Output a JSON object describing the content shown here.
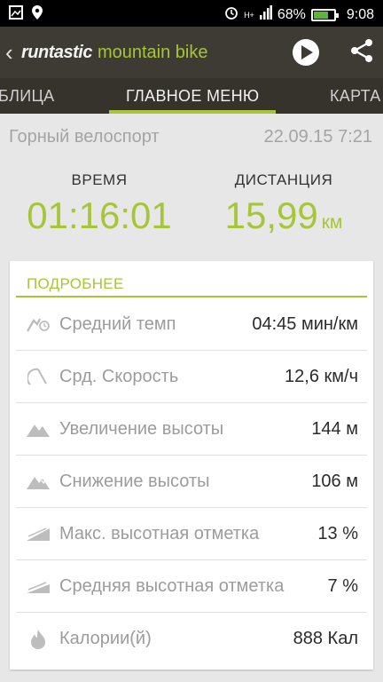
{
  "statusbar": {
    "battery_percent": "68%",
    "time": "9:08",
    "network": "H+"
  },
  "appbar": {
    "brand_name": "runtastic",
    "brand_product": "mountain bike"
  },
  "tabs": {
    "left": "БЛИЦА",
    "main": "ГЛАВНОЕ МЕНЮ",
    "right": "КАРТА"
  },
  "activity": {
    "sport": "Горный велоспорт",
    "datetime": "22.09.15 7:21"
  },
  "metrics": {
    "time_label": "ВРЕМЯ",
    "time_value": "01:16:01",
    "distance_label": "ДИСТАНЦИЯ",
    "distance_value": "15,99",
    "distance_unit": "км"
  },
  "details": {
    "header": "ПОДРОБНЕЕ",
    "rows": [
      {
        "label": "Средний темп",
        "value": "04:45 мин/км",
        "icon": "pace-icon"
      },
      {
        "label": "Срд. Скорость",
        "value": "12,6  км/ч",
        "icon": "speedometer-icon"
      },
      {
        "label": "Увеличение высоты",
        "value": "144 м",
        "icon": "elevation-gain-icon"
      },
      {
        "label": "Снижение высоты",
        "value": "106 м",
        "icon": "elevation-loss-icon"
      },
      {
        "label": "Макс. высотная отметка",
        "value": "13 %",
        "icon": "max-grade-icon"
      },
      {
        "label": "Средняя высотная отметка",
        "value": "7 %",
        "icon": "avg-grade-icon"
      },
      {
        "label": "Калории(й)",
        "value": "888 Кал",
        "icon": "flame-icon"
      }
    ]
  },
  "colors": {
    "accent": "#a6c638",
    "appbar": "#3e3a34",
    "tabs": "#36322c",
    "background": "#e7e7e7"
  }
}
